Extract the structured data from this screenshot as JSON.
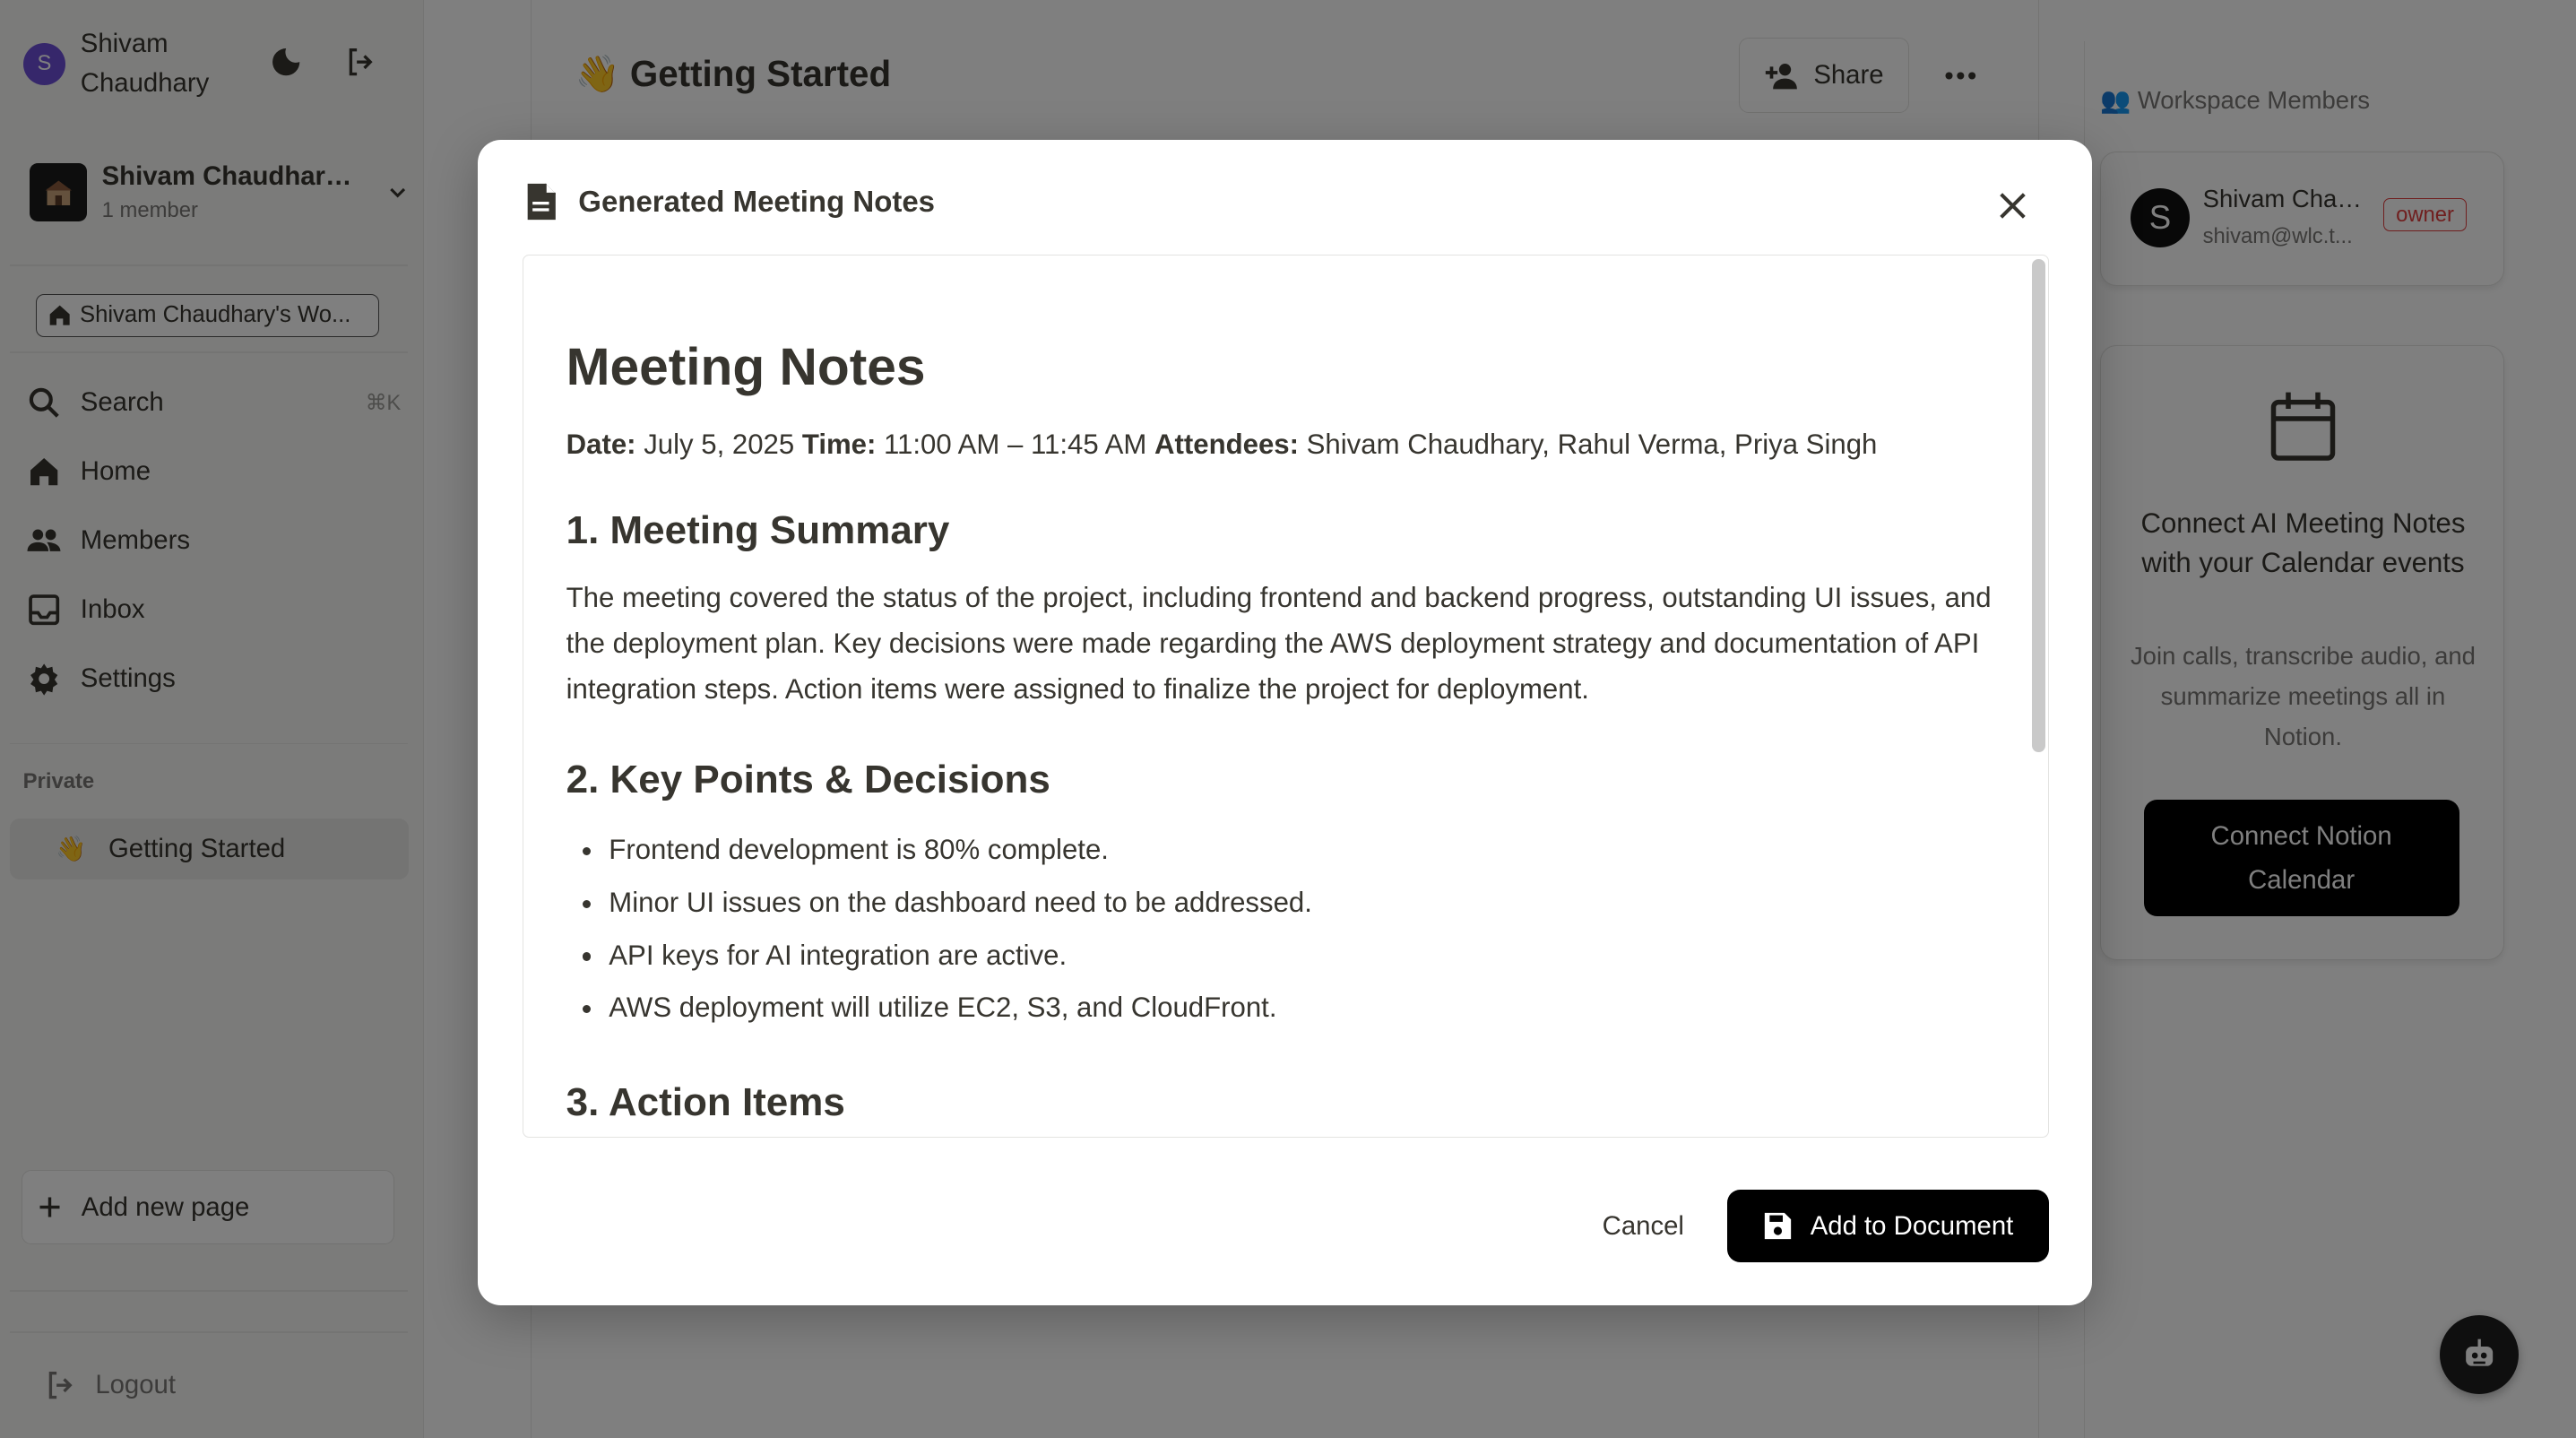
{
  "sidebar": {
    "user": {
      "initial": "S",
      "name": "Shivam Chaudhary"
    },
    "workspace": {
      "name": "Shivam Chaudhary'...",
      "members": "1 member",
      "chip": "Shivam Chaudhary's Wo..."
    },
    "nav": {
      "search": "Search",
      "search_shortcut": "⌘K",
      "home": "Home",
      "members": "Members",
      "inbox": "Inbox",
      "settings": "Settings"
    },
    "private_label": "Private",
    "page": {
      "emoji": "👋",
      "title": "Getting Started"
    },
    "add_page": "Add new page",
    "logout": "Logout"
  },
  "main": {
    "emoji": "👋",
    "title": "Getting Started",
    "share_label": "Share"
  },
  "right_panel": {
    "workspace_members_label": "Workspace Members",
    "member": {
      "initial": "S",
      "name": "Shivam Chaudhary",
      "email": "shivam@wlc.t...",
      "role": "owner"
    },
    "calendar_card": {
      "title": "Connect AI Meeting Notes with your Calendar events",
      "description": "Join calls, transcribe audio, and summarize meetings all in Notion.",
      "button": "Connect Notion Calendar"
    }
  },
  "modal": {
    "title": "Generated Meeting Notes",
    "doc": {
      "heading": "Meeting Notes",
      "date_label": "Date:",
      "date": "July 5, 2025",
      "time_label": "Time:",
      "time": "11:00 AM – 11:45 AM",
      "attendees_label": "Attendees:",
      "attendees": "Shivam Chaudhary, Rahul Verma, Priya Singh",
      "section1": "1. Meeting Summary",
      "summary": "The meeting covered the status of the project, including frontend and backend progress, outstanding UI issues, and the deployment plan. Key decisions were made regarding the AWS deployment strategy and documentation of API integration steps. Action items were assigned to finalize the project for deployment.",
      "section2": "2. Key Points & Decisions",
      "points": [
        "Frontend development is 80% complete.",
        "Minor UI issues on the dashboard need to be addressed.",
        "API keys for AI integration are active.",
        "AWS deployment will utilize EC2, S3, and CloudFront."
      ],
      "section3": "3. Action Items"
    },
    "cancel_label": "Cancel",
    "add_label": "Add to Document"
  }
}
